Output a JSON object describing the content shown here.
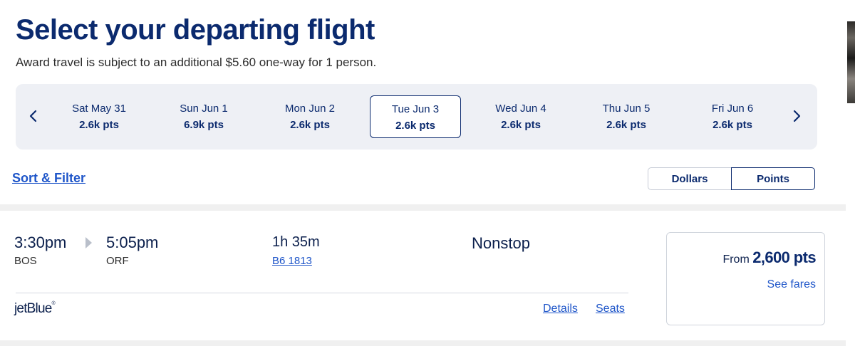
{
  "header": {
    "title": "Select your departing flight",
    "subtitle": "Award travel is subject to an additional $5.60 one-way for 1 person."
  },
  "date_nav": {
    "prev_icon": "chevron-left-icon",
    "next_icon": "chevron-right-icon",
    "dates": [
      {
        "date": "Sat May 31",
        "price": "2.6k pts",
        "selected": false
      },
      {
        "date": "Sun Jun 1",
        "price": "6.9k pts",
        "selected": false
      },
      {
        "date": "Mon Jun 2",
        "price": "2.6k pts",
        "selected": false
      },
      {
        "date": "Tue Jun 3",
        "price": "2.6k pts",
        "selected": true
      },
      {
        "date": "Wed Jun 4",
        "price": "2.6k pts",
        "selected": false
      },
      {
        "date": "Thu Jun 5",
        "price": "2.6k pts",
        "selected": false
      },
      {
        "date": "Fri Jun 6",
        "price": "2.6k pts",
        "selected": false
      }
    ]
  },
  "controls": {
    "sort_filter_label": "Sort & Filter",
    "currency_toggle": {
      "dollars_label": "Dollars",
      "points_label": "Points",
      "selected": "Points"
    }
  },
  "flight": {
    "depart_time": "3:30pm",
    "depart_airport": "BOS",
    "arrive_time": "5:05pm",
    "arrive_airport": "ORF",
    "duration": "1h 35m",
    "flight_number": "B6 1813",
    "stops": "Nonstop",
    "airline": "jetBlue",
    "details_label": "Details",
    "seats_label": "Seats",
    "fare": {
      "from_label": "From",
      "points": "2,600 pts",
      "see_fares_label": "See fares"
    }
  },
  "colors": {
    "brand_navy": "#0b2a6e",
    "link_blue": "#1f56c9",
    "strip_bg": "#eef0f5",
    "page_bg": "#f0f0f0"
  }
}
